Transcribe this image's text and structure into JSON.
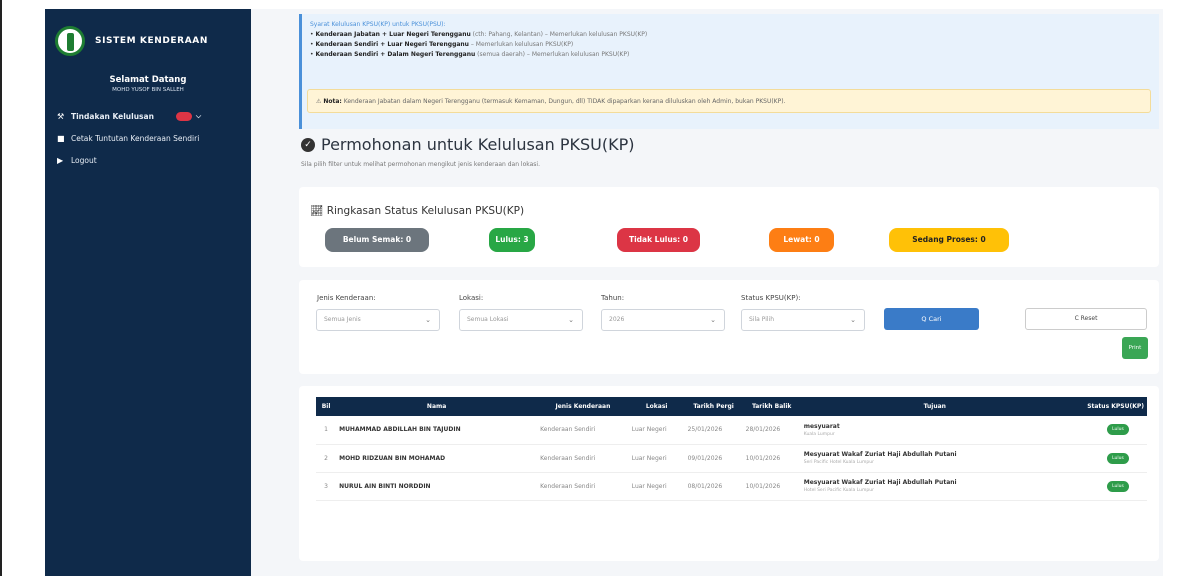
{
  "sidebar": {
    "brand": "SISTEM KENDERAAN",
    "welcome": "Selamat Datang",
    "user": "MOHD YUSOF BIN SALLEH",
    "items": [
      {
        "label": "Tindakan Kelulusan",
        "icon": "wrench-icon"
      },
      {
        "label": "Cetak Tuntutan Kenderaan Sendiri",
        "icon": "file-icon"
      },
      {
        "label": "Logout",
        "icon": "logout-icon"
      }
    ]
  },
  "info": {
    "heading": "Syarat Kelulusan KPSU(KP) untuk PKSU(PSU):",
    "lines": [
      {
        "bold": "Kenderaan Jabatan + Luar Negeri Terengganu",
        "rest": " (cth: Pahang, Kelantan) – Memerlukan kelulusan PKSU(KP)"
      },
      {
        "bold": "Kenderaan Sendiri + Luar Negeri Terengganu",
        "rest": " – Memerlukan kelulusan PKSU(KP)"
      },
      {
        "bold": "Kenderaan Sendiri + Dalam Negeri Terengganu",
        "rest": " (semua daerah) – Memerlukan kelulusan PKSU(KP)"
      }
    ],
    "note_label": "Nota:",
    "note_text": " Kenderaan Jabatan dalam Negeri Terengganu (termasuk Kemaman, Dungun, dll) TIDAK dipaparkan kerana diluluskan oleh Admin, bukan PKSU(KP)."
  },
  "page": {
    "title": "Permohonan untuk Kelulusan PKSU(KP)",
    "subtitle": "Sila pilih filter untuk melihat permohonan mengikut jenis kenderaan dan lokasi."
  },
  "summary": {
    "heading": "Ringkasan Status Kelulusan PKSU(KP)",
    "pills": [
      {
        "label": "Belum Semak: 0",
        "color": "#6c757d"
      },
      {
        "label": "Lulus: 3",
        "color": "#28a745"
      },
      {
        "label": "Tidak Lulus: 0",
        "color": "#dc3545"
      },
      {
        "label": "Lewat: 0",
        "color": "#fd7e14"
      },
      {
        "label": "Sedang Proses: 0",
        "color": "#ffc107"
      }
    ]
  },
  "filters": {
    "jenis_label": "Jenis Kenderaan:",
    "jenis_value": "Semua Jenis",
    "lokasi_label": "Lokasi:",
    "lokasi_value": "Semua Lokasi",
    "tahun_label": "Tahun:",
    "tahun_value": "2026",
    "status_label": "Status KPSU(KP):",
    "status_value": "Sila Pilih",
    "cari": "Q Cari",
    "reset": "C Reset",
    "print": "Print"
  },
  "table": {
    "headers": [
      "Bil",
      "Nama",
      "Jenis Kenderaan",
      "Lokasi",
      "Tarikh Pergi",
      "Tarikh Balik",
      "Tujuan",
      "Status KPSU(KP)"
    ],
    "rows": [
      {
        "bil": "1",
        "nama": "MUHAMMAD ABDILLAH BIN TAJUDIN",
        "jenis": "Kenderaan Sendiri",
        "lokasi": "Luar Negeri",
        "pergi": "25/01/2026",
        "balik": "28/01/2026",
        "tujuan": "mesyuarat",
        "tempat": "Kuala Lumpur",
        "status": "Lulus"
      },
      {
        "bil": "2",
        "nama": "MOHD RIDZUAN BIN MOHAMAD",
        "jenis": "Kenderaan Sendiri",
        "lokasi": "Luar Negeri",
        "pergi": "09/01/2026",
        "balik": "10/01/2026",
        "tujuan": "Mesyuarat Wakaf Zuriat Haji Abdullah Putani",
        "tempat": "Seri Pacific Hotel Kuala Lumpur",
        "status": "Lulus"
      },
      {
        "bil": "3",
        "nama": "NURUL AIN BINTI NORDDIN",
        "jenis": "Kenderaan Sendiri",
        "lokasi": "Luar Negeri",
        "pergi": "08/01/2026",
        "balik": "10/01/2026",
        "tujuan": "Mesyuarat Wakaf Zuriat Haji Abdullah Putani",
        "tempat": "Hotel Seri Pacific Kuala Lumpur",
        "status": "Lulus"
      }
    ]
  }
}
